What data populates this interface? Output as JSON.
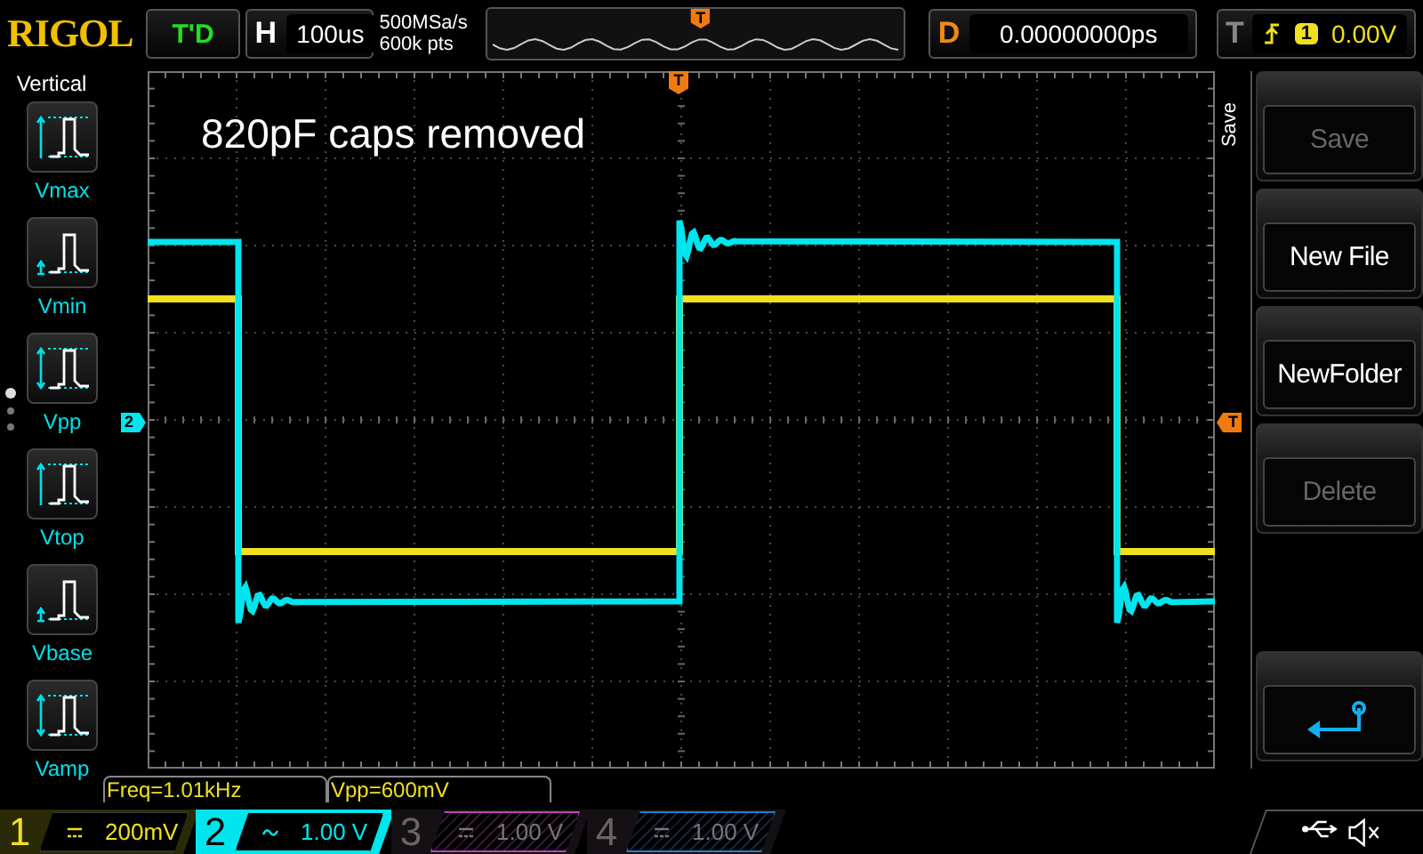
{
  "logo": "RIGOL",
  "run_status": "T'D",
  "horizontal": {
    "label": "H",
    "timebase": "100us"
  },
  "acquisition": {
    "sample_rate": "500MSa/s",
    "memory_depth": "600k pts"
  },
  "overview": {
    "trigger_marker": "T"
  },
  "delay": {
    "label": "D",
    "value": "0.00000000ps"
  },
  "trigger": {
    "label": "T",
    "source": "1",
    "level": "0.00V"
  },
  "sidebar": {
    "title": "Vertical",
    "page_dots": [
      {
        "selected": true
      },
      {
        "selected": false
      },
      {
        "selected": false
      }
    ],
    "items": [
      {
        "label": "Vmax",
        "kind": "max"
      },
      {
        "label": "Vmin",
        "kind": "min"
      },
      {
        "label": "Vpp",
        "kind": "pp"
      },
      {
        "label": "Vtop",
        "kind": "top"
      },
      {
        "label": "Vbase",
        "kind": "base"
      },
      {
        "label": "Vamp",
        "kind": "amp"
      }
    ]
  },
  "screen": {
    "annotation": "820pF caps removed",
    "channel_marker": "2",
    "trigger_marker": "T",
    "top_trigger_marker": "T"
  },
  "menu": {
    "title": "Save",
    "buttons": [
      {
        "kind": "text",
        "label": "Save",
        "disabled": true
      },
      {
        "kind": "text",
        "label": "New File",
        "disabled": false
      },
      {
        "kind": "text",
        "label": "NewFolder",
        "disabled": false
      },
      {
        "kind": "text",
        "label": "Delete",
        "disabled": true
      },
      {
        "kind": "return"
      }
    ]
  },
  "measurements": [
    "Freq=1.01kHz",
    "Vpp=600mV"
  ],
  "channels": [
    {
      "number": "1",
      "kind": "dc",
      "scale": "200mV",
      "enabled": true,
      "selected": false,
      "color": "#f0e020"
    },
    {
      "number": "2",
      "kind": "ac",
      "scale": "1.00 V",
      "enabled": true,
      "selected": true,
      "color": "#00e5ee"
    },
    {
      "number": "3",
      "kind": "dc",
      "scale": "1.00 V",
      "enabled": false,
      "selected": false,
      "color": "#c040c0"
    },
    {
      "number": "4",
      "kind": "dc",
      "scale": "1.00 V",
      "enabled": false,
      "selected": false,
      "color": "#2080d0"
    }
  ]
}
